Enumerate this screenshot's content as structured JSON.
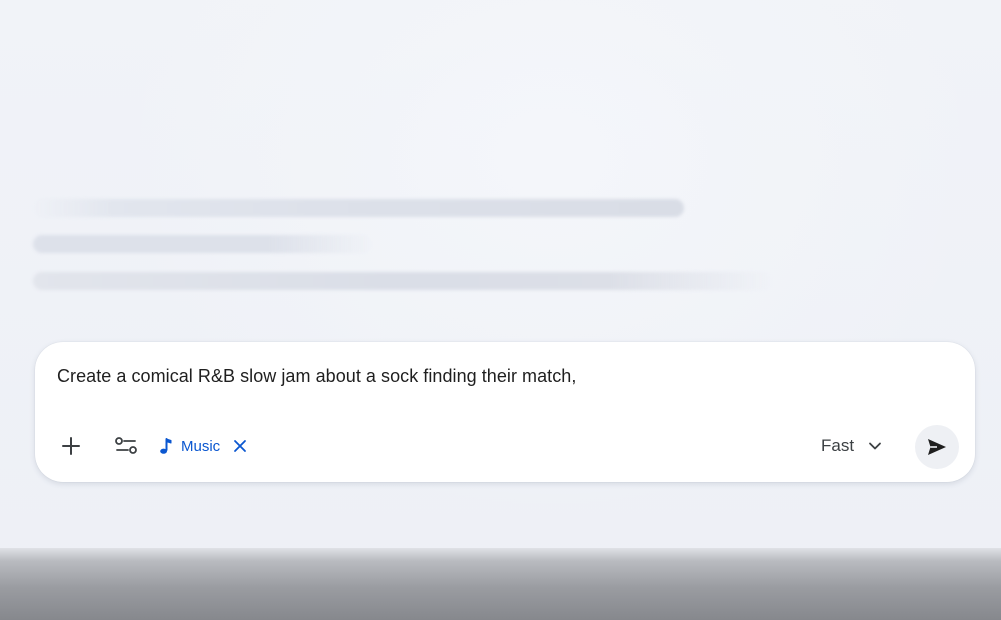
{
  "composer": {
    "prompt_text": "Create a comical R&B slow jam about a sock finding their match,",
    "add_icon": "plus-icon",
    "tools_icon": "tune-sliders-icon",
    "music_chip": {
      "icon": "music-note-icon",
      "label": "Music",
      "close_icon": "close-icon"
    },
    "model": {
      "label": "Fast",
      "icon": "chevron-down-icon"
    },
    "send_icon": "send-arrow-icon"
  },
  "colors": {
    "background": "#eff2f8",
    "accent": "#0b57d0",
    "text": "#1f1f1f"
  }
}
